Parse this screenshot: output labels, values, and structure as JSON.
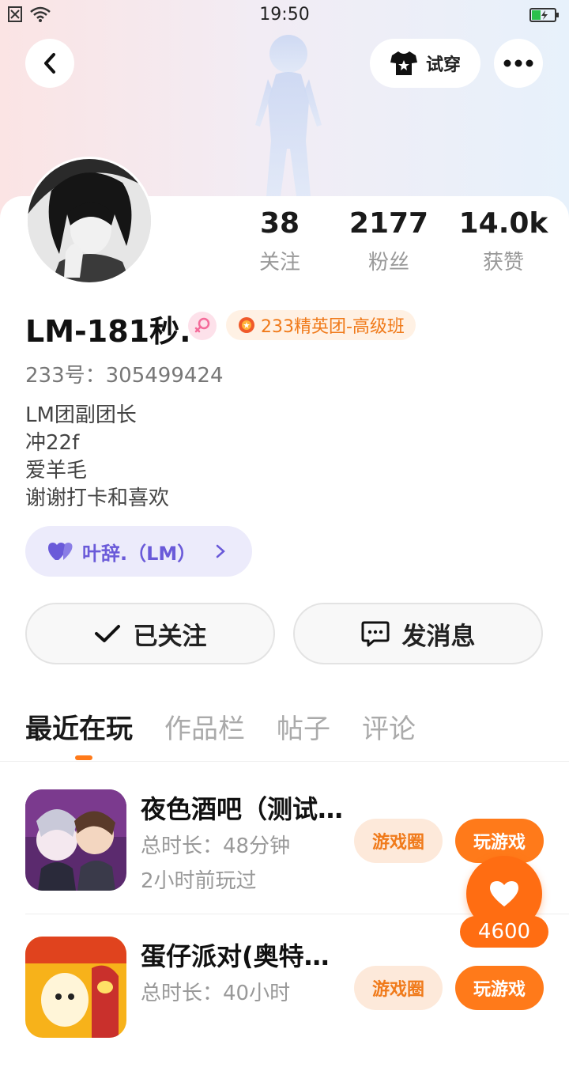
{
  "status_bar": {
    "time": "19:50"
  },
  "header": {
    "try_on_label": "试穿"
  },
  "profile": {
    "name": "LM-181秒.",
    "badge": "233精英团-高级班",
    "uid": "233号：305499424",
    "bio": [
      "LM团副团长",
      "冲22f",
      "爱羊毛",
      "谢谢打卡和喜欢"
    ],
    "group_label": "叶辞.（LM）"
  },
  "stats": [
    {
      "value": "38",
      "label": "关注"
    },
    {
      "value": "2177",
      "label": "粉丝"
    },
    {
      "value": "14.0k",
      "label": "获赞"
    }
  ],
  "actions": {
    "followed_label": "已关注",
    "message_label": "发消息"
  },
  "tabs": [
    "最近在玩",
    "作品栏",
    "帖子",
    "评论"
  ],
  "games": [
    {
      "title": "夜色酒吧（测试服）",
      "duration": "总时长：48分钟",
      "last_played": "2小时前玩过",
      "circle_label": "游戏圈",
      "play_label": "玩游戏"
    },
    {
      "title": "蛋仔派对(奥特曼联动)",
      "duration": "总时长：40小时",
      "last_played": "",
      "circle_label": "游戏圈",
      "play_label": "玩游戏"
    }
  ],
  "like": {
    "count": "4600"
  },
  "colors": {
    "accent": "#ff7a1a",
    "group_purple": "#6a5ad9"
  }
}
